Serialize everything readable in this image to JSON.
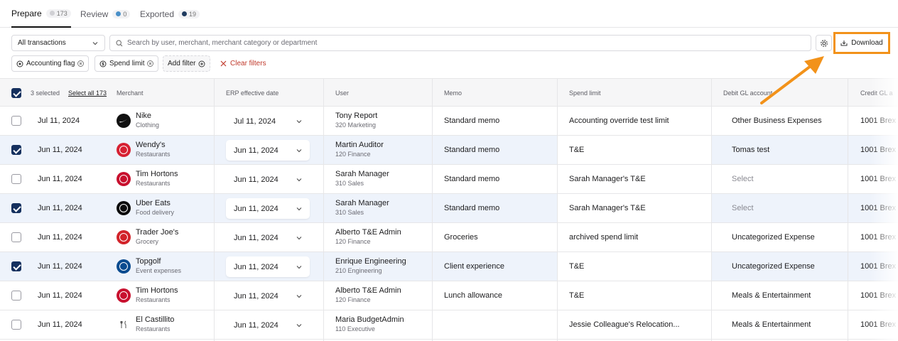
{
  "tabs": [
    {
      "label": "Prepare",
      "count": "173",
      "dot_color": "#d0d0d4"
    },
    {
      "label": "Review",
      "count": "0",
      "dot_color": "#4a90c8"
    },
    {
      "label": "Exported",
      "count": "19",
      "dot_color": "#1f3a5f"
    }
  ],
  "toolbar": {
    "transactions_select": "All transactions",
    "search_placeholder": "Search by user, merchant, merchant category or department",
    "download_label": "Download"
  },
  "filters": {
    "chips": [
      "Accounting flag",
      "Spend limit"
    ],
    "add_filter": "Add filter",
    "clear": "Clear filters"
  },
  "table": {
    "selected_text": "3 selected",
    "select_all": "Select all 173",
    "headers": {
      "merchant": "Merchant",
      "erp_date": "ERP effective date",
      "user": "User",
      "memo": "Memo",
      "spend_limit": "Spend limit",
      "debit_gl": "Debit GL account",
      "credit_gl": "Credit GL a"
    },
    "rows": [
      {
        "selected": false,
        "date": "Jul 11, 2024",
        "merchant": "Nike",
        "category": "Clothing",
        "logo": "nike-icon",
        "logo_color": "#111111",
        "erp": "Jul 11, 2024",
        "user": "Tony Report",
        "dept": "320 Marketing",
        "memo": "Standard memo",
        "spend": "Accounting override test limit",
        "debit": "Other Business Expenses",
        "debit_placeholder": false,
        "credit": "1001 Brex"
      },
      {
        "selected": true,
        "date": "Jun 11, 2024",
        "merchant": "Wendy's",
        "category": "Restaurants",
        "logo": "wendys-icon",
        "logo_color": "#d62032",
        "erp": "Jun 11, 2024",
        "user": "Martin Auditor",
        "dept": "120 Finance",
        "memo": "Standard memo",
        "spend": "T&E",
        "debit": "Tomas test",
        "debit_placeholder": false,
        "credit": "1001 Brex"
      },
      {
        "selected": false,
        "date": "Jun 11, 2024",
        "merchant": "Tim Hortons",
        "category": "Restaurants",
        "logo": "tim-hortons-icon",
        "logo_color": "#c8102e",
        "erp": "Jun 11, 2024",
        "user": "Sarah Manager",
        "dept": "310 Sales",
        "memo": "Standard memo",
        "spend": "Sarah Manager's T&E",
        "debit": "Select",
        "debit_placeholder": true,
        "credit": "1001 Brex"
      },
      {
        "selected": true,
        "date": "Jun 11, 2024",
        "merchant": "Uber Eats",
        "category": "Food delivery",
        "logo": "uber-eats-icon",
        "logo_color": "#0b0b0b",
        "erp": "Jun 11, 2024",
        "user": "Sarah Manager",
        "dept": "310 Sales",
        "memo": "Standard memo",
        "spend": "Sarah Manager's T&E",
        "debit": "Select",
        "debit_placeholder": true,
        "credit": "1001 Brex"
      },
      {
        "selected": false,
        "date": "Jun 11, 2024",
        "merchant": "Trader Joe's",
        "category": "Grocery",
        "logo": "trader-joes-icon",
        "logo_color": "#d2232a",
        "erp": "Jun 11, 2024",
        "user": "Alberto T&E Admin",
        "dept": "120 Finance",
        "memo": "Groceries",
        "spend": "archived spend limit",
        "debit": "Uncategorized Expense",
        "debit_placeholder": false,
        "credit": "1001 Brex"
      },
      {
        "selected": true,
        "date": "Jun 11, 2024",
        "merchant": "Topgolf",
        "category": "Event expenses",
        "logo": "topgolf-icon",
        "logo_color": "#0a4b8f",
        "erp": "Jun 11, 2024",
        "user": "Enrique Engineering",
        "dept": "210 Engineering",
        "memo": "Client experience",
        "spend": "T&E",
        "debit": "Uncategorized Expense",
        "debit_placeholder": false,
        "credit": "1001 Brex"
      },
      {
        "selected": false,
        "date": "Jun 11, 2024",
        "merchant": "Tim Hortons",
        "category": "Restaurants",
        "logo": "tim-hortons-icon",
        "logo_color": "#c8102e",
        "erp": "Jun 11, 2024",
        "user": "Alberto T&E Admin",
        "dept": "120 Finance",
        "memo": "Lunch allowance",
        "spend": "T&E",
        "debit": "Meals & Entertainment",
        "debit_placeholder": false,
        "credit": "1001 Brex"
      },
      {
        "selected": false,
        "date": "Jun 11, 2024",
        "merchant": "El Castillito",
        "category": "Restaurants",
        "logo": "utensils-icon",
        "logo_color": "#ffffff",
        "erp": "Jun 11, 2024",
        "user": "Maria BudgetAdmin",
        "dept": "110 Executive",
        "memo": "",
        "spend": "Jessie Colleague's Relocation...",
        "debit": "Meals & Entertainment",
        "debit_placeholder": false,
        "credit": "1001 Brex"
      }
    ]
  },
  "colors": {
    "accent": "#15305e",
    "highlight": "#f2921a",
    "selected_row": "#eef3fb"
  }
}
